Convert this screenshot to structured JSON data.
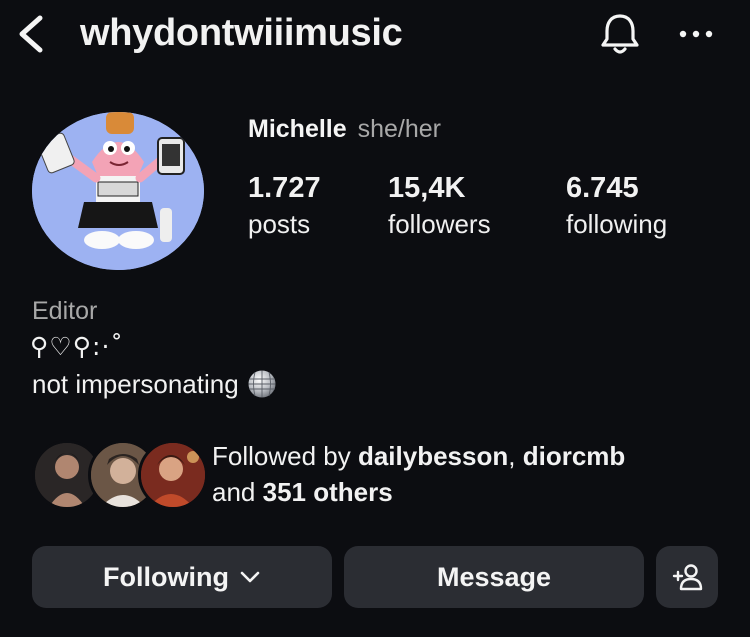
{
  "header": {
    "username": "whydontwiiimusic",
    "back_icon": "chevron-left-icon",
    "notification_icon": "bell-icon",
    "more_icon": "more-horizontal-icon"
  },
  "profile": {
    "display_name": "Michelle",
    "pronouns": "she/her",
    "stats": {
      "posts": {
        "value": "1.727",
        "label": "posts"
      },
      "followers": {
        "value": "15,4K",
        "label": "followers"
      },
      "following": {
        "value": "6.745",
        "label": "following"
      }
    },
    "category": "Editor",
    "bio_line1": "⚲♡⚲:·˚",
    "bio_line2": "not impersonating",
    "bio_emoji": "disco-ball-icon"
  },
  "followed_by": {
    "prefix": "Followed by",
    "user1": "dailybesson",
    "separator": ",",
    "user2": "diorcmb",
    "and_text": "and",
    "others": "351 others"
  },
  "buttons": {
    "following_label": "Following",
    "message_label": "Message",
    "add_user_icon": "add-user-icon"
  },
  "colors": {
    "background": "#0c0d11",
    "button_bg": "#2b2d33",
    "secondary_text": "#a8a8a8"
  }
}
